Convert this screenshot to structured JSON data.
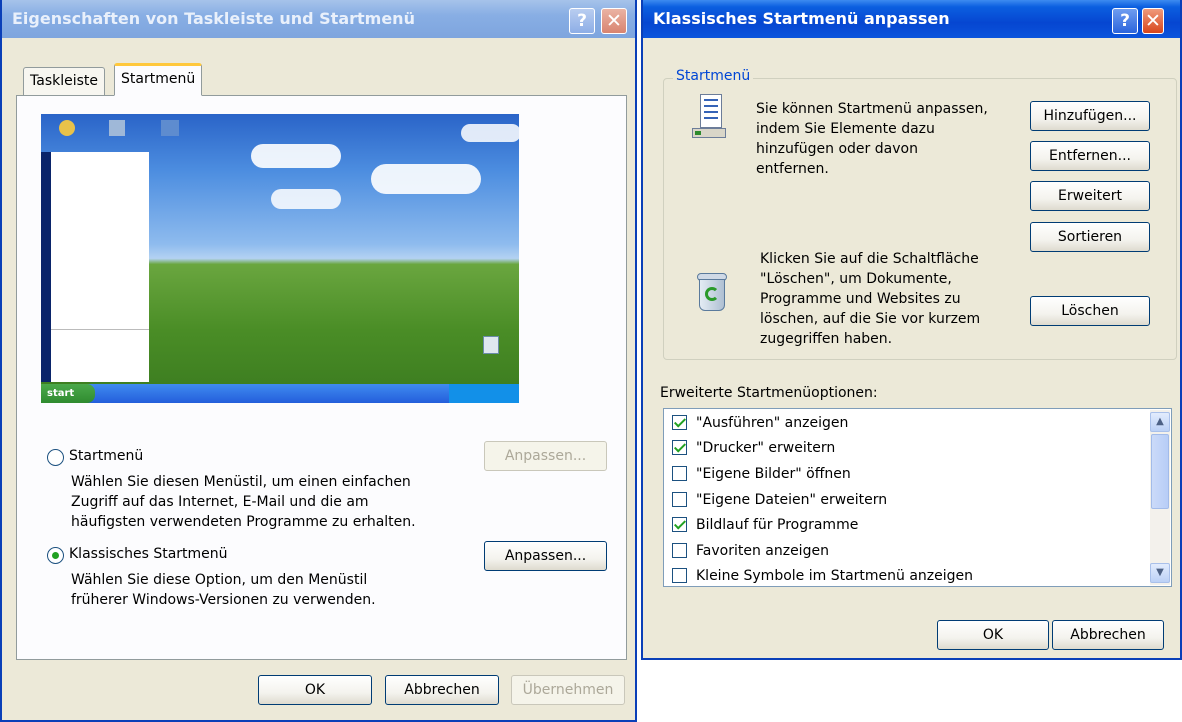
{
  "left_dialog": {
    "title": "Eigenschaften von Taskleiste und Startmenü",
    "help_glyph": "?",
    "close_glyph": "✕",
    "tabs": [
      "Taskleiste",
      "Startmenü"
    ],
    "preview_start_label": "start",
    "options": [
      {
        "label": "Startmenü",
        "checked": false,
        "description": [
          "Wählen Sie diesen Menüstil, um einen einfachen",
          "Zugriff auf das Internet, E-Mail und die am",
          "häufigsten verwendeten Programme zu erhalten."
        ],
        "button": "Anpassen...",
        "button_enabled": false
      },
      {
        "label": "Klassisches Startmenü",
        "checked": true,
        "description": [
          "Wählen Sie diese Option, um den Menüstil",
          "früherer Windows-Versionen zu verwenden."
        ],
        "button": "Anpassen...",
        "button_enabled": true
      }
    ],
    "buttons": {
      "ok": "OK",
      "cancel": "Abbrechen",
      "apply": "Übernehmen"
    }
  },
  "right_dialog": {
    "title": "Klassisches Startmenü anpassen",
    "help_glyph": "?",
    "close_glyph": "✕",
    "group_title": "Startmenü",
    "customize_text": [
      "Sie können Startmenü anpassen,",
      "indem Sie Elemente dazu",
      "hinzufügen oder davon",
      "entfernen."
    ],
    "clear_text": [
      "Klicken Sie auf die Schaltfläche",
      "\"Löschen\", um Dokumente,",
      "Programme und Websites zu",
      "löschen, auf die Sie vor kurzem",
      "zugegriffen haben."
    ],
    "buttons": {
      "add": "Hinzufügen...",
      "remove": "Entfernen...",
      "advanced": "Erweitert",
      "sort": "Sortieren",
      "clear": "Löschen",
      "ok": "OK",
      "cancel": "Abbrechen"
    },
    "advanced_label": "Erweiterte Startmenüoptionen:",
    "advanced_options": [
      {
        "label": "\"Ausführen\" anzeigen",
        "checked": true
      },
      {
        "label": "\"Drucker\" erweitern",
        "checked": true
      },
      {
        "label": "\"Eigene Bilder\" öffnen",
        "checked": false
      },
      {
        "label": "\"Eigene Dateien\" erweitern",
        "checked": false
      },
      {
        "label": "Bildlauf für Programme",
        "checked": true
      },
      {
        "label": "Favoriten anzeigen",
        "checked": false
      },
      {
        "label": "Kleine Symbole im Startmenü anzeigen",
        "checked": false
      }
    ]
  }
}
